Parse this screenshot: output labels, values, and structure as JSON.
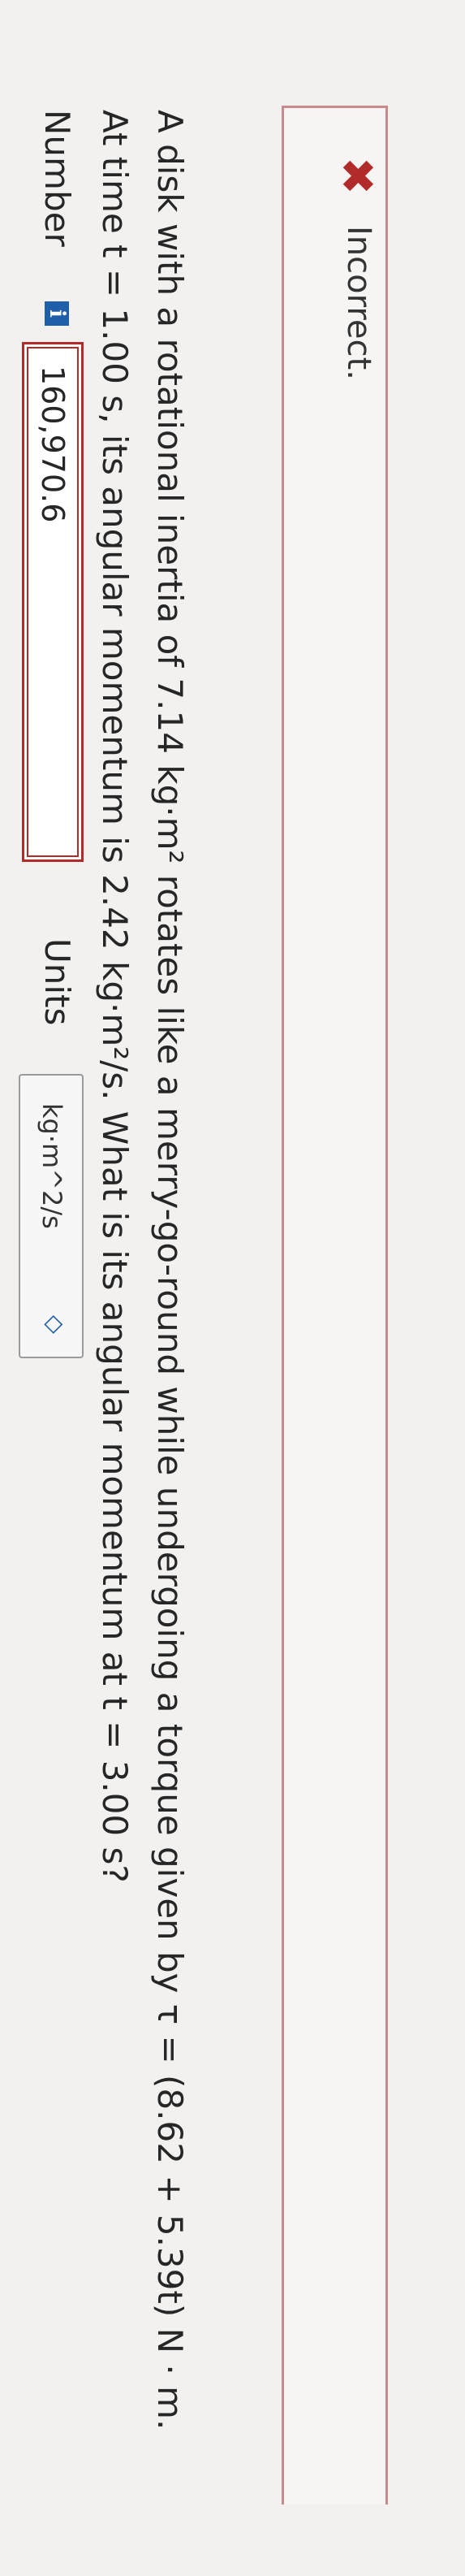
{
  "feedback": {
    "icon": "close-icon",
    "symbol": "✖",
    "text": "Incorrect."
  },
  "question": {
    "line1": "A disk with a rotational inertia of 7.14 kg·m² rotates like a merry-go-round while undergoing a torque given by τ = (8.62 + 5.39t) N · m.",
    "line2": "At time t = 1.00 s, its angular momentum is 2.42 kg·m²/s. What is its angular momentum at t = 3.00 s?"
  },
  "answer": {
    "number_label": "Number",
    "info_icon": "i",
    "value": "160,970.6",
    "units_label": "Units",
    "units_value": "kg·m^2/s",
    "chevron_icon": "chevron-up-down-icon"
  },
  "colors": {
    "error": "#b42a2a",
    "accent": "#1f5ea8"
  }
}
